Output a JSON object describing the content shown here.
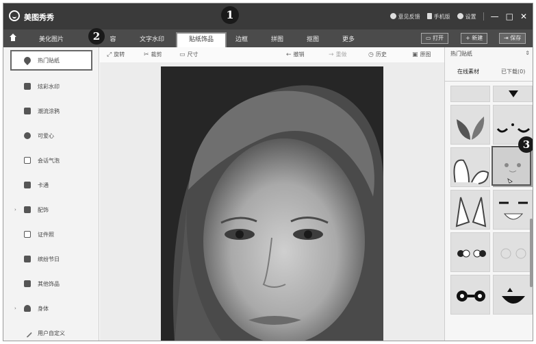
{
  "app": {
    "title": "美图秀秀"
  },
  "titlebar": {
    "feedback": "意见反馈",
    "mobile": "手机版",
    "settings": "设置",
    "minimize": "—",
    "maximize": "□",
    "close": "✕"
  },
  "nav": {
    "tabs": [
      "美化图片",
      "容",
      "文字水印",
      "贴纸饰品",
      "边框",
      "拼图",
      "抠图",
      "更多"
    ],
    "active_index": 3,
    "open_label": "打开",
    "new_label": "+ 新建",
    "save_label": "保存"
  },
  "sidebar": {
    "items": [
      {
        "label": "热门贴纸",
        "icon": "flame-icon"
      },
      {
        "label": "炫彩水印",
        "icon": "watermark-icon"
      },
      {
        "label": "潮流涂鸦",
        "icon": "doodle-icon"
      },
      {
        "label": "可爱心",
        "icon": "heart-icon"
      },
      {
        "label": "会话气泡",
        "icon": "speech-bubble-icon"
      },
      {
        "label": "卡通",
        "icon": "cartoon-icon"
      },
      {
        "label": "配饰",
        "icon": "bow-icon"
      },
      {
        "label": "证件照",
        "icon": "id-photo-icon"
      },
      {
        "label": "缤纷节日",
        "icon": "festival-icon"
      },
      {
        "label": "其他饰品",
        "icon": "grid-icon"
      },
      {
        "label": "身体",
        "icon": "body-icon"
      },
      {
        "label": "用户自定义",
        "icon": "pen-icon"
      }
    ],
    "active_index": 0
  },
  "toolbar": {
    "rotate": "旋转",
    "crop": "裁剪",
    "size": "尺寸",
    "undo": "撤销",
    "redo": "重做",
    "history": "历史",
    "original": "原图"
  },
  "right_panel": {
    "title": "热门贴纸",
    "tab_online": "在线素材",
    "tab_downloaded": "已下载(0)"
  },
  "callouts": [
    "1",
    "2",
    "3"
  ],
  "colors": {
    "titlebar": "#3a3a3a",
    "navbar": "#4b4b4b",
    "sidebar": "#f3f3f3",
    "canvas": "#ececec"
  }
}
